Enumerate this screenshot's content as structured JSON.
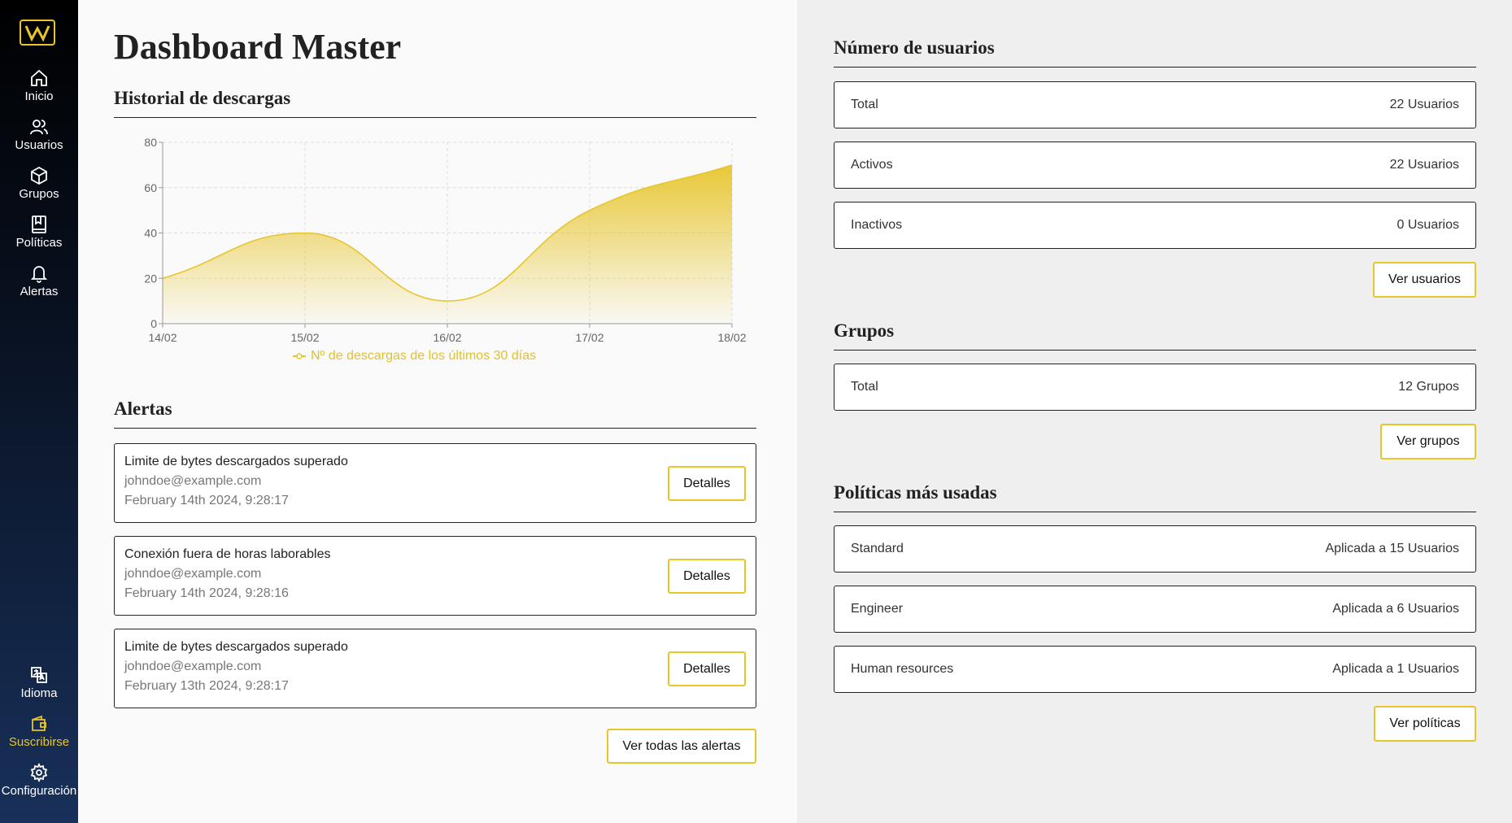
{
  "sidebar": {
    "items": [
      {
        "label": "Inicio",
        "icon": "home-icon"
      },
      {
        "label": "Usuarios",
        "icon": "users-icon"
      },
      {
        "label": "Grupos",
        "icon": "cube-icon"
      },
      {
        "label": "Políticas",
        "icon": "book-icon"
      },
      {
        "label": "Alertas",
        "icon": "bell-icon"
      }
    ],
    "bottom_items": [
      {
        "label": "Idioma",
        "icon": "translate-icon"
      },
      {
        "label": "Suscribirse",
        "icon": "wallet-icon"
      },
      {
        "label": "Configuración",
        "icon": "gear-icon"
      }
    ]
  },
  "colors": {
    "accent": "#e7c52d",
    "sidebar_top": "#000000",
    "sidebar_bottom": "#18305a"
  },
  "page_title": "Dashboard Master",
  "downloads": {
    "title": "Historial de descargas"
  },
  "chart_data": {
    "type": "area",
    "x": [
      "14/02",
      "15/02",
      "16/02",
      "17/02",
      "18/02"
    ],
    "series": [
      {
        "name": "Nº de descargas de los últimos 30 días",
        "values": [
          20,
          40,
          10,
          50,
          70
        ]
      }
    ],
    "ylim": [
      0,
      80
    ],
    "yticks": [
      0,
      20,
      40,
      60,
      80
    ],
    "grid": true,
    "legend": "bottom",
    "color": "#e7c52d"
  },
  "alerts": {
    "title": "Alertas",
    "items": [
      {
        "title": "Limite de bytes descargados superado",
        "email": "johndoe@example.com",
        "date": "February 14th 2024, 9:28:17",
        "button": "Detalles"
      },
      {
        "title": "Conexión fuera de horas laborables",
        "email": "johndoe@example.com",
        "date": "February 14th 2024, 9:28:16",
        "button": "Detalles"
      },
      {
        "title": "Limite de bytes descargados superado",
        "email": "johndoe@example.com",
        "date": "February 13th 2024, 9:28:17",
        "button": "Detalles"
      }
    ],
    "view_all": "Ver todas las alertas"
  },
  "users": {
    "title": "Número de usuarios",
    "rows": [
      {
        "label": "Total",
        "value": "22 Usuarios"
      },
      {
        "label": "Activos",
        "value": "22 Usuarios"
      },
      {
        "label": "Inactivos",
        "value": "0 Usuarios"
      }
    ],
    "button": "Ver usuarios"
  },
  "groups": {
    "title": "Grupos",
    "rows": [
      {
        "label": "Total",
        "value": "12 Grupos"
      }
    ],
    "button": "Ver grupos"
  },
  "policies": {
    "title": "Políticas más usadas",
    "rows": [
      {
        "label": "Standard",
        "value": "Aplicada a 15 Usuarios"
      },
      {
        "label": "Engineer",
        "value": "Aplicada a 6 Usuarios"
      },
      {
        "label": "Human resources",
        "value": "Aplicada a 1 Usuarios"
      }
    ],
    "button": "Ver políticas"
  }
}
